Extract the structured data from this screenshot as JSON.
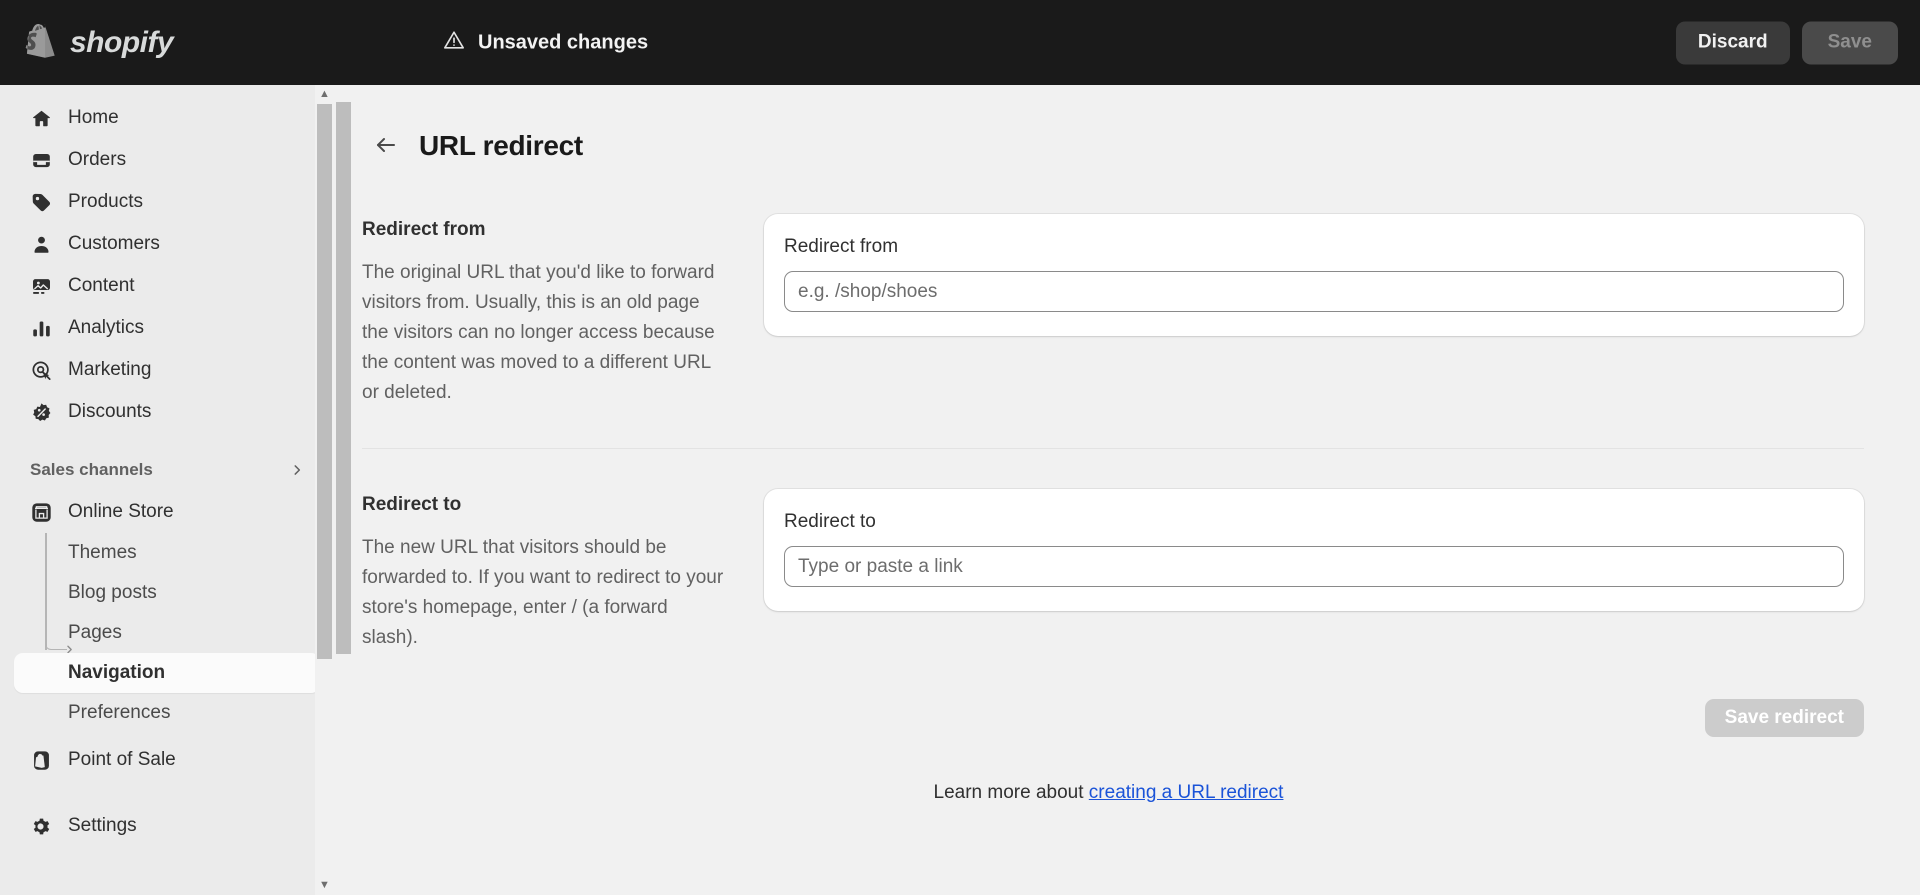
{
  "topbar": {
    "brand": "shopify",
    "brand_icon": "shopify-bag-icon",
    "status_icon": "warning-triangle-icon",
    "status_text": "Unsaved changes",
    "discard_label": "Discard",
    "save_label": "Save"
  },
  "sidebar": {
    "items": [
      {
        "label": "Home",
        "icon": "home-icon"
      },
      {
        "label": "Orders",
        "icon": "orders-inbox-icon"
      },
      {
        "label": "Products",
        "icon": "product-tag-icon"
      },
      {
        "label": "Customers",
        "icon": "customer-person-icon"
      },
      {
        "label": "Content",
        "icon": "content-image-icon"
      },
      {
        "label": "Analytics",
        "icon": "analytics-bars-icon"
      },
      {
        "label": "Marketing",
        "icon": "marketing-target-icon"
      },
      {
        "label": "Discounts",
        "icon": "discount-badge-icon"
      }
    ],
    "section": {
      "label": "Sales channels",
      "chevron_icon": "chevron-right-icon"
    },
    "channels": [
      {
        "label": "Online Store",
        "icon": "online-store-icon"
      }
    ],
    "sub_items": [
      {
        "label": "Themes",
        "active": false
      },
      {
        "label": "Blog posts",
        "active": false
      },
      {
        "label": "Pages",
        "active": false
      },
      {
        "label": "Navigation",
        "active": true
      },
      {
        "label": "Preferences",
        "active": false
      }
    ],
    "pos": {
      "label": "Point of Sale",
      "icon": "point-of-sale-icon"
    },
    "settings": {
      "label": "Settings",
      "icon": "gear-icon"
    },
    "scroll_up_icon": "scroll-up-arrow",
    "scroll_down_icon": "scroll-down-arrow"
  },
  "page": {
    "back_icon": "arrow-left-icon",
    "title": "URL redirect",
    "sections": [
      {
        "title": "Redirect from",
        "description": "The original URL that you'd like to forward visitors from. Usually, this is an old page the visitors can no longer access because the content was moved to a different URL or deleted.",
        "field_label": "Redirect from",
        "placeholder": "e.g. /shop/shoes",
        "value": ""
      },
      {
        "title": "Redirect to",
        "description": "The new URL that visitors should be forwarded to. If you want to redirect to your store's homepage, enter / (a forward slash).",
        "field_label": "Redirect to",
        "placeholder": "Type or paste a link",
        "value": ""
      }
    ],
    "save_redirect_label": "Save redirect",
    "footer": {
      "text": "Learn more about ",
      "link_text": "creating a URL redirect"
    }
  },
  "colors": {
    "topbar_bg": "#1a1a1a",
    "sidebar_bg": "#ebebeb",
    "page_bg": "#f1f1f1",
    "card_bg": "#ffffff",
    "link": "#1a53d8",
    "disabled_button": "#cccccc"
  }
}
